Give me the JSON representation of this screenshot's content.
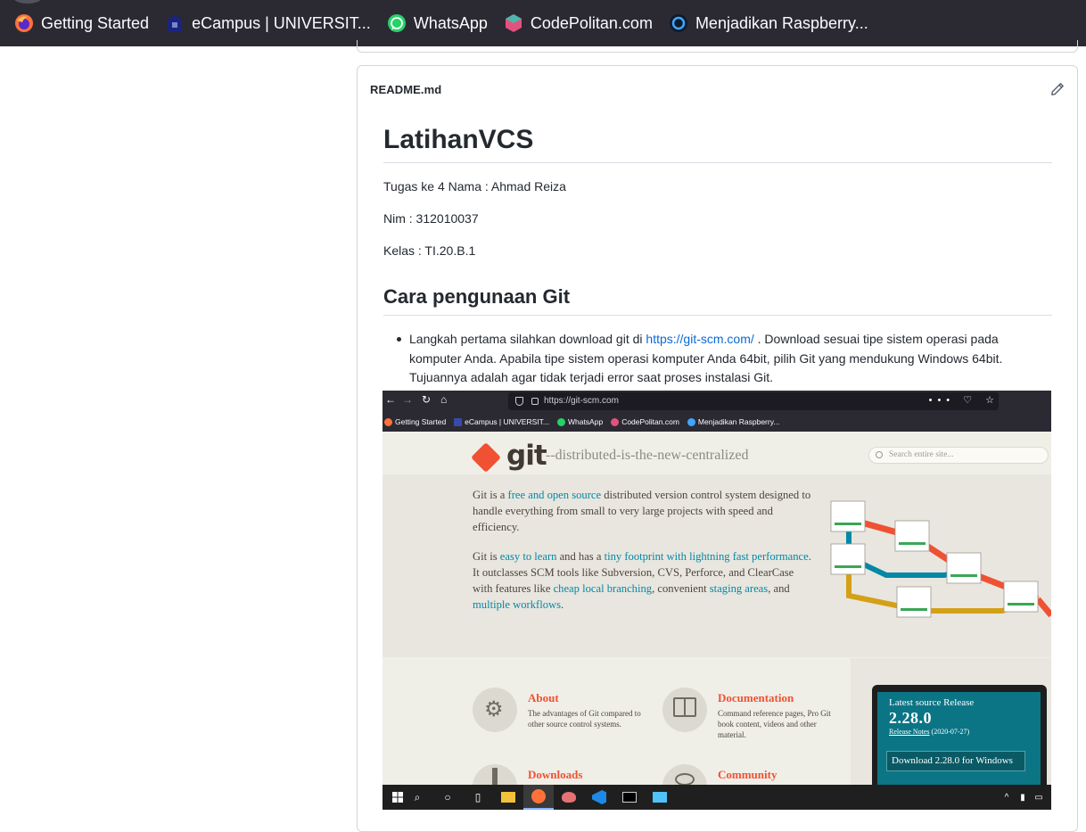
{
  "browser": {
    "bookmarks": [
      {
        "label": "Getting Started",
        "icon": "firefox-icon"
      },
      {
        "label": "eCampus | UNIVERSIT...",
        "icon": "campus-icon"
      },
      {
        "label": "WhatsApp",
        "icon": "whatsapp-icon"
      },
      {
        "label": "CodePolitan.com",
        "icon": "codepolitan-icon"
      },
      {
        "label": "Menjadikan Raspberry...",
        "icon": "raspberry-icon"
      }
    ]
  },
  "readme": {
    "filename": "README.md",
    "edit_icon": "pencil-icon",
    "title": "LatihanVCS",
    "lines": [
      "Tugas ke 4 Nama : Ahmad Reiza",
      "Nim : 312010037",
      "Kelas : TI.20.B.1"
    ],
    "section_title": "Cara pengunaan Git",
    "bullet": {
      "before_link": "Langkah pertama silahkan download git di ",
      "link": "https://git-scm.com/",
      "after_link": " . Download sesuai tipe sistem operasi pada komputer Anda. Apabila tipe sistem operasi komputer Anda 64bit, pilih Git yang mendukung Windows 64bit. Tujuannya adalah agar tidak terjadi error saat proses instalasi Git."
    }
  },
  "screenshot": {
    "url": "https://git-scm.com",
    "toolbar_tools": "••• ♡ ☆",
    "bookmarks": [
      "Getting Started",
      "eCampus | UNIVERSIT...",
      "WhatsApp",
      "CodePolitan.com",
      "Menjadikan Raspberry..."
    ],
    "site": {
      "logo": "git",
      "tagline": "--distributed-is-the-new-centralized",
      "search_placeholder": "Search entire site...",
      "hero": {
        "p1_a": "Git is a ",
        "p1_link": "free and open source",
        "p1_b": " distributed version control system designed to handle everything from small to very large projects with speed and efficiency.",
        "p2_a": "Git is ",
        "p2_link1": "easy to learn",
        "p2_b": " and has a ",
        "p2_link2": "tiny footprint with lightning fast performance",
        "p2_c": ". It outclasses SCM tools like Subversion, CVS, Perforce, and ClearCase with features like ",
        "p2_link3": "cheap local branching",
        "p2_d": ", convenient ",
        "p2_link4": "staging areas",
        "p2_e": ", and ",
        "p2_link5": "multiple workflows",
        "p2_f": "."
      },
      "features": [
        {
          "title": "About",
          "desc": "The advantages of Git compared to other source control systems.",
          "icon": "gears-icon"
        },
        {
          "title": "Documentation",
          "desc": "Command reference pages, Pro Git book content, videos and other material.",
          "icon": "book-icon"
        },
        {
          "title": "Downloads",
          "desc": "",
          "icon": "download-icon"
        },
        {
          "title": "Community",
          "desc": "",
          "icon": "community-icon"
        }
      ],
      "release": {
        "label": "Latest source Release",
        "version": "2.28.0",
        "notes_link": "Release Notes",
        "notes_date": "(2020-07-27)",
        "button": "Download 2.28.0 for Windows"
      }
    }
  },
  "colors": {
    "firefox_chrome": "#2b2a33",
    "git_orange": "#f05133",
    "git_teal": "#0b7585",
    "link_blue": "#0969da"
  }
}
